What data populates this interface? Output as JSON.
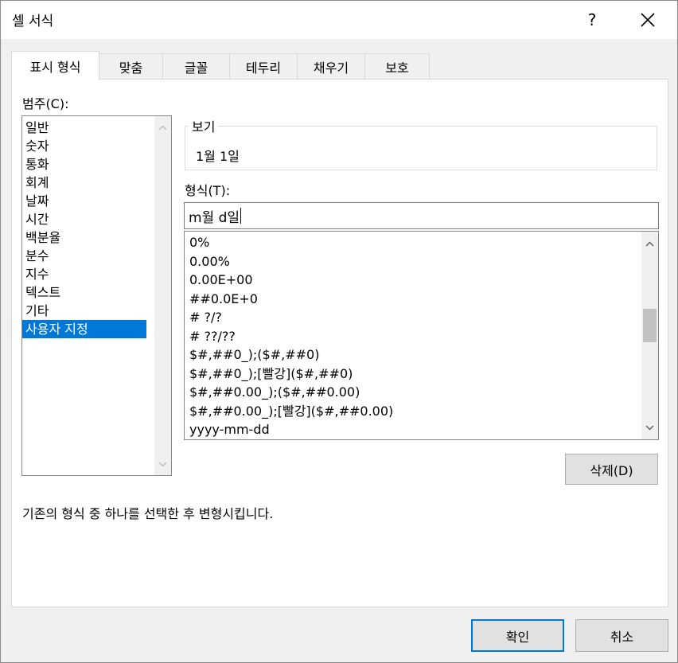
{
  "window": {
    "title": "셀 서식",
    "help_label": "?",
    "close_icon": "close-icon"
  },
  "tabs": [
    {
      "label": "표시 형식",
      "active": true
    },
    {
      "label": "맞춤",
      "active": false
    },
    {
      "label": "글꼴",
      "active": false
    },
    {
      "label": "테두리",
      "active": false
    },
    {
      "label": "채우기",
      "active": false
    },
    {
      "label": "보호",
      "active": false
    }
  ],
  "category": {
    "label": "범주(C):",
    "selected": "사용자 지정",
    "items": [
      "일반",
      "숫자",
      "통화",
      "회계",
      "날짜",
      "시간",
      "백분율",
      "분수",
      "지수",
      "텍스트",
      "기타",
      "사용자 지정"
    ]
  },
  "sample": {
    "legend": "보기",
    "value": "1월 1일"
  },
  "format": {
    "label": "형식(T):",
    "input_value": "m월 d일",
    "items": [
      "0%",
      "0.00%",
      "0.00E+00",
      "##0.0E+0",
      "# ?/?",
      "# ??/??",
      "$#,##0_);($#,##0)",
      "$#,##0_);[빨강]($#,##0)",
      "$#,##0.00_);($#,##0.00)",
      "$#,##0.00_);[빨강]($#,##0.00)",
      "yyyy-mm-dd"
    ]
  },
  "buttons": {
    "delete": "삭제(D)",
    "ok": "확인",
    "cancel": "취소"
  },
  "description": "기존의 형식 중 하나를 선택한 후 변형시킵니다.",
  "colors": {
    "selection": "#0078d7",
    "dialog_bg": "#f0f0f0"
  }
}
